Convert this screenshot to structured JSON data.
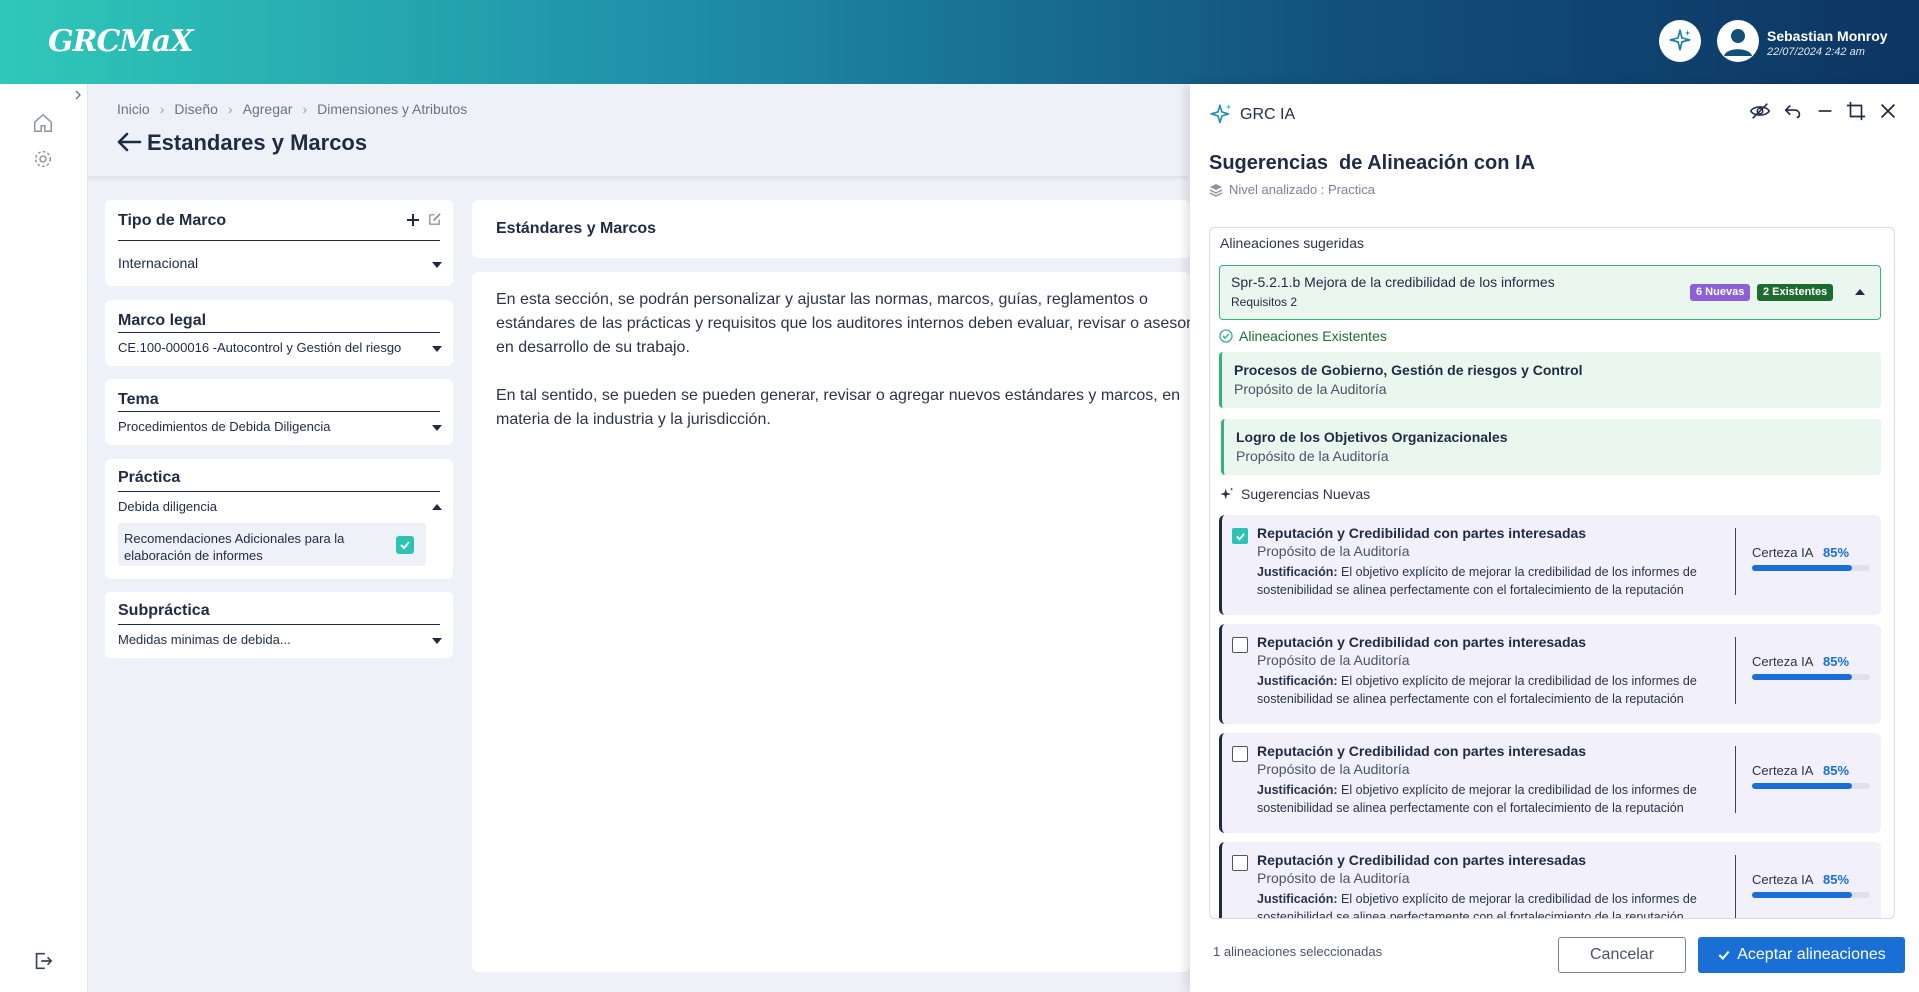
{
  "app": {
    "logo": "GRCMaX"
  },
  "user": {
    "name": "Sebastian Monroy",
    "datetime": "22/07/2024  2:42 am"
  },
  "breadcrumb": [
    "Inicio",
    "Diseño",
    "Agregar",
    "Dimensiones y Atributos"
  ],
  "page_title": "Estandares y Marcos",
  "filters": {
    "tipo": {
      "title": "Tipo de Marco",
      "value": "Internacional"
    },
    "marco": {
      "title": "Marco legal",
      "value": "CE.100-000016 -Autocontrol y Gestión del riesgo"
    },
    "tema": {
      "title": "Tema",
      "value": "Procedimientos de Debida Diligencia"
    },
    "practica": {
      "title": "Práctica",
      "value": "Debida diligencia",
      "sub_item": "Recomendaciones Adicionales para la elaboración de informes"
    },
    "subpractica": {
      "title": "Subpráctica",
      "value": "Medidas minimas de debida..."
    }
  },
  "content": {
    "title": "Estándares y Marcos",
    "paragraph1": "En esta sección, se podrán personalizar y ajustar las normas, marcos, guías, reglamentos o estándares de las prácticas y requisitos que los auditores internos deben evaluar, revisar o asesorar, en desarrollo de su trabajo.",
    "paragraph2": "En tal sentido, se pueden se pueden generar, revisar o agregar nuevos estándares y marcos, en materia de la industria y la jurisdicción."
  },
  "panel": {
    "brand": "GRC IA",
    "title": "Sugerencias  de Alineación con IA",
    "level": "Nivel analizado : Practica",
    "suggested_label": "Alineaciones sugeridas",
    "requirement": {
      "title": "Spr-5.2.1.b Mejora de la credibilidad de los informes",
      "sub": "Requisitos 2",
      "badge_new": "6 Nuevas",
      "badge_existing": "2 Existentes"
    },
    "existing_label": "Alineaciones Existentes",
    "existing": [
      {
        "title": "Procesos de Gobierno, Gestión de riesgos y Control",
        "sub": "Propósito de la Auditoría"
      },
      {
        "title": "Logro de los Objetivos Organizacionales",
        "sub": "Propósito de la Auditoría"
      }
    ],
    "new_label": "Sugerencias Nuevas",
    "suggestions": [
      {
        "title": "Reputación y Credibilidad con partes interesadas",
        "sub": "Propósito de la Auditoría",
        "just_label": "Justificación:",
        "just": " El objetivo explícito de mejorar la credibilidad de los informes de sostenibilidad se alinea perfectamente con el fortalecimiento de la reputación",
        "cert_label": "Certeza IA",
        "cert": "85%",
        "cert_value": 0.85,
        "checked": true
      },
      {
        "title": "Reputación y Credibilidad con partes interesadas",
        "sub": "Propósito de la Auditoría",
        "just_label": "Justificación:",
        "just": " El objetivo explícito de mejorar la credibilidad de los informes de sostenibilidad se alinea perfectamente con el fortalecimiento de la reputación",
        "cert_label": "Certeza IA",
        "cert": "85%",
        "cert_value": 0.85,
        "checked": false
      },
      {
        "title": "Reputación y Credibilidad con partes interesadas",
        "sub": "Propósito de la Auditoría",
        "just_label": "Justificación:",
        "just": " El objetivo explícito de mejorar la credibilidad de los informes de sostenibilidad se alinea perfectamente con el fortalecimiento de la reputación",
        "cert_label": "Certeza IA",
        "cert": "85%",
        "cert_value": 0.85,
        "checked": false
      },
      {
        "title": "Reputación y Credibilidad con partes interesadas",
        "sub": "Propósito de la Auditoría",
        "just_label": "Justificación:",
        "just": " El objetivo explícito de mejorar la credibilidad de los informes de sostenibilidad se alinea perfectamente con el fortalecimiento de la reputación",
        "cert_label": "Certeza IA",
        "cert": "85%",
        "cert_value": 0.85,
        "checked": false
      }
    ],
    "footer_count": "1 alineaciones seleccionadas",
    "cancel_label": "Cancelar",
    "accept_label": "Aceptar alineaciones"
  },
  "colors": {
    "accent": "#1a6fd6",
    "teal": "#2cc3b2",
    "success": "#34b37a",
    "badge_new": "#8e5fd6",
    "badge_existing": "#1e6b2f"
  },
  "icons": [
    "sparkle-icon",
    "user-avatar-icon",
    "home-icon",
    "gear-icon",
    "chevron-right-icon",
    "logout-icon",
    "back-arrow-icon",
    "plus-icon",
    "edit-icon",
    "eye-off-icon",
    "undo-icon",
    "minimize-icon",
    "crop-icon",
    "close-icon",
    "layers-icon",
    "check-circle-icon",
    "chevron-up-icon",
    "checkmark-icon"
  ]
}
